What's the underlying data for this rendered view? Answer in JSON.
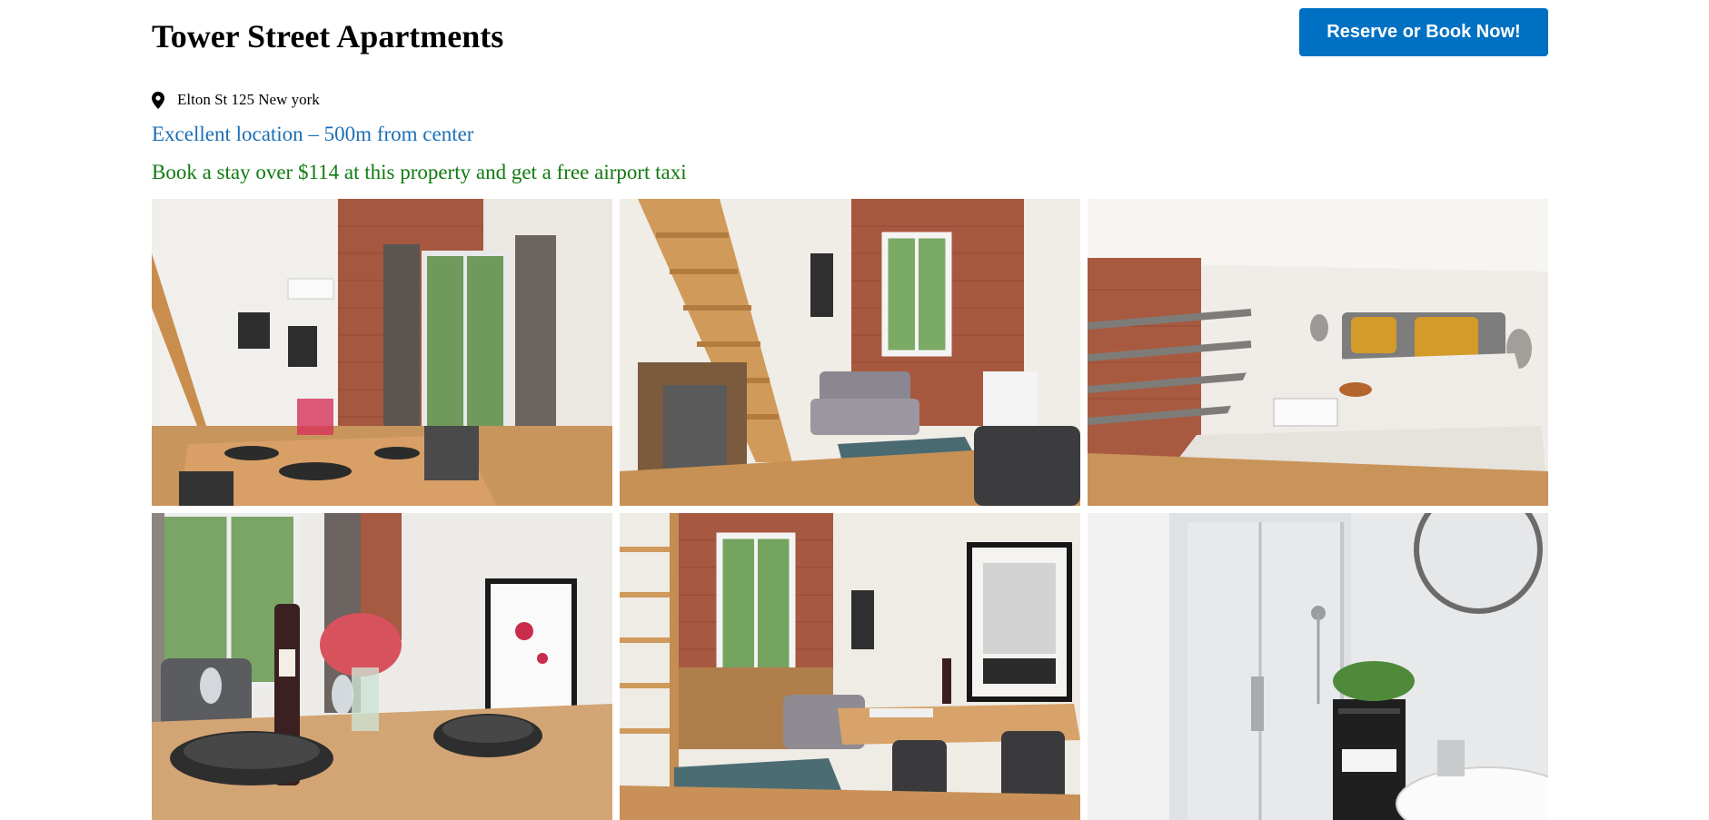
{
  "header": {
    "title": "Tower Street Apartments",
    "cta_label": "Reserve or Book Now!"
  },
  "property": {
    "address": "Elton St 125 New york",
    "location_note": "Excellent location – 500m from center",
    "promo_note": "Book a stay over $114 at this property and get a free airport taxi"
  },
  "colors": {
    "accent": "#0071c2",
    "location_text": "#1a6fb5",
    "promo_text": "#107a10"
  },
  "gallery": {
    "photos": [
      {
        "icon": "dining-room-photo"
      },
      {
        "icon": "living-room-stairs-photo"
      },
      {
        "icon": "loft-bedroom-photo"
      },
      {
        "icon": "dining-table-closeup-photo"
      },
      {
        "icon": "living-dining-photo"
      },
      {
        "icon": "bathroom-photo"
      }
    ]
  }
}
